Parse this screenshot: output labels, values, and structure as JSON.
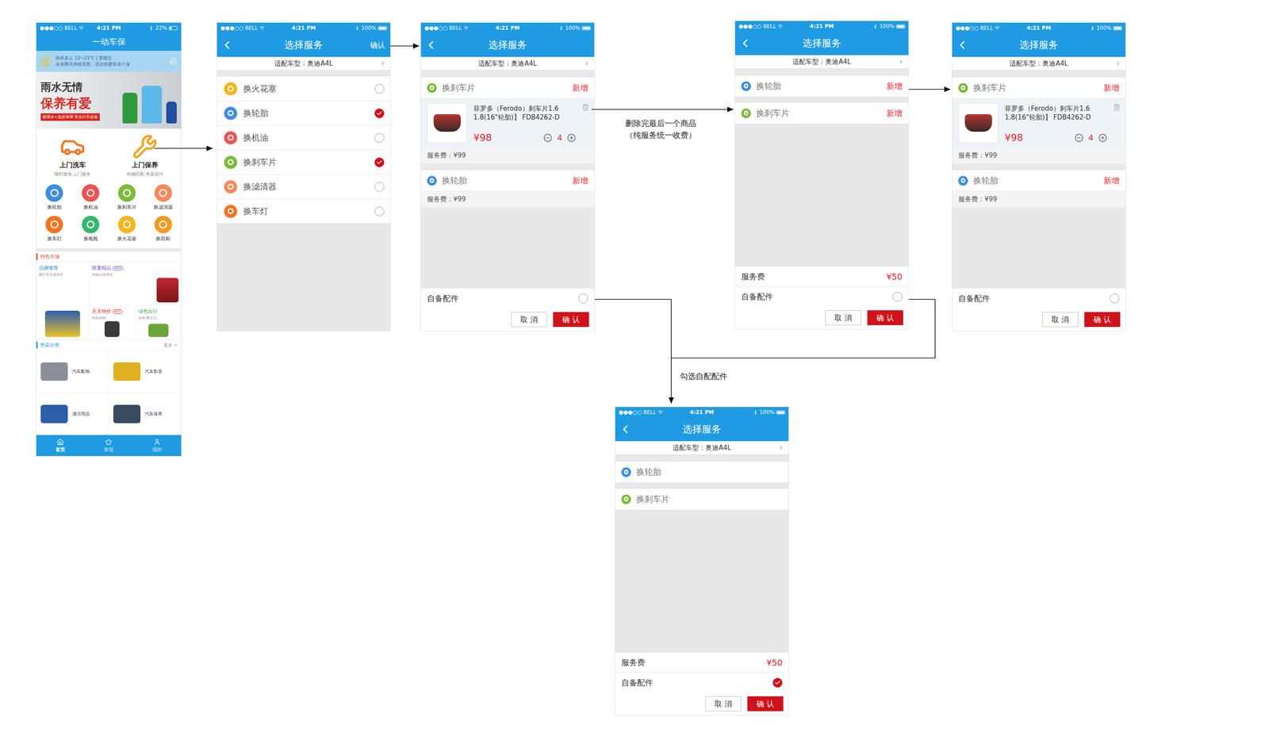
{
  "annotations": [
    {
      "lines": [
        "删除完最后一个商品",
        "（纯服务统一收费）"
      ]
    },
    {
      "lines": [
        "勾选自配配件"
      ]
    }
  ],
  "home": {
    "status": {
      "carrier": "●●●○○ BELL",
      "time": "4:21 PM",
      "battery": "22%"
    },
    "title": "一动车保",
    "weather": {
      "line1": "雨夹多云 13~23°C | 星期五",
      "line2": "未来两天持续无雨，适合给爱车洗个澡"
    },
    "banner": {
      "lines": [
        "雨水无情",
        "保养有爱"
      ],
      "caption": "玻璃水+低价保养 安全行车必备"
    },
    "services": [
      {
        "name": "上门洗车",
        "desc": "随时随地 上门服务"
      },
      {
        "name": "上门保养",
        "desc": "精确匹配 先装后付"
      }
    ],
    "shortcuts": [
      {
        "label": "换轮胎",
        "color": "#3d8ee0"
      },
      {
        "label": "换机油",
        "color": "#f05450"
      },
      {
        "label": "换刹车片",
        "color": "#7dbb3c"
      },
      {
        "label": "换滤清器",
        "color": "#f58a5a"
      },
      {
        "label": "换车灯",
        "color": "#f5731e"
      },
      {
        "label": "换电瓶",
        "color": "#33b86b"
      },
      {
        "label": "换火花塞",
        "color": "#f7b51c"
      },
      {
        "label": "换雨刷",
        "color": "#f59a23"
      }
    ],
    "featured": {
      "title": "特色市场",
      "items": [
        {
          "name": "品牌推荐",
          "desc": "暖炉安全成就车",
          "badge": "",
          "color": "#2f7fd6"
        },
        {
          "name": "限量精品",
          "desc": "特惠品质保证",
          "badge": "NEW",
          "color": "#7a4fc9"
        },
        {
          "name": "天天特价",
          "desc": "特美抢购",
          "badge": "HOT",
          "color": "#e8262d"
        },
        {
          "name": "绿色出行",
          "desc": "绿色·爱生活",
          "badge": "",
          "color": "#3aa64a"
        }
      ]
    },
    "hot": {
      "title": "热卖分类",
      "more": "更多 >",
      "items": [
        "汽车配饰",
        "汽车影音",
        "清洁用品",
        "汽车保养"
      ]
    },
    "tabs": [
      {
        "label": "首页",
        "selected": true
      },
      {
        "label": "发现",
        "selected": false
      },
      {
        "label": "我的",
        "selected": false
      }
    ]
  },
  "screens": [
    {
      "kind": "checklist",
      "status": {
        "carrier": "●●●○○ BELL",
        "time": "4:21 PM",
        "battery": "100%"
      },
      "title": "选择服务",
      "action": "确认",
      "model": "适配车型：奥迪A4L",
      "options": [
        {
          "label": "换火花塞",
          "color": "#f7b51c",
          "checked": false
        },
        {
          "label": "换轮胎",
          "color": "#3d8ee0",
          "checked": true
        },
        {
          "label": "换机油",
          "color": "#f05450",
          "checked": false
        },
        {
          "label": "换刹车片",
          "color": "#7dbb3c",
          "checked": true
        },
        {
          "label": "换滤清器",
          "color": "#f58a5a",
          "checked": false
        },
        {
          "label": "换车灯",
          "color": "#f5731e",
          "checked": false
        }
      ]
    },
    {
      "kind": "cart",
      "status": {
        "carrier": "●●●○○ BELL",
        "time": "4:21 PM",
        "battery": "100%"
      },
      "title": "选择服务",
      "action": "",
      "model": "适配车型：奥迪A4L",
      "sections": [
        {
          "name": "换刹车片",
          "color": "#7dbb3c",
          "tag": "新增",
          "product": {
            "name": "菲罗多（Ferodo）刹车片1.6 1.8(16\"轮胎)】 FDB4262-D",
            "price": "¥98",
            "qty": "4"
          },
          "fee": "服务费：¥99"
        },
        {
          "name": "换轮胎",
          "color": "#3d8ee0",
          "tag": "新增",
          "fee": "服务费：¥99"
        }
      ],
      "ownParts": {
        "label": "自备配件",
        "checked": false
      },
      "buttons": [
        "取 消",
        "确 认"
      ]
    },
    {
      "kind": "cart",
      "status": {
        "carrier": "●●●○○ BELL",
        "time": "4:21 PM",
        "battery": "100%"
      },
      "title": "选择服务",
      "action": "",
      "model": "适配车型：奥迪A4L",
      "sections": [
        {
          "name": "换轮胎",
          "color": "#3d8ee0",
          "tag": "新增"
        },
        {
          "name": "换刹车片",
          "color": "#7dbb3c",
          "tag": "新增"
        }
      ],
      "total": {
        "label": "服务费",
        "value": "¥50"
      },
      "ownParts": {
        "label": "自备配件",
        "checked": false
      },
      "buttons": [
        "取 消",
        "确 认"
      ]
    },
    {
      "kind": "cart",
      "status": {
        "carrier": "●●●○○ BELL",
        "time": "4:21 PM",
        "battery": "100%"
      },
      "title": "选择服务",
      "action": "",
      "model": "适配车型：奥迪A4L",
      "sections": [
        {
          "name": "换刹车片",
          "color": "#7dbb3c",
          "tag": "新增",
          "product": {
            "name": "菲罗多（Ferodo）刹车片1.6 1.8(16\"轮胎)】 FDB4262-D",
            "price": "¥98",
            "qty": "4"
          },
          "fee": "服务费：¥99"
        },
        {
          "name": "换轮胎",
          "color": "#3d8ee0",
          "tag": "新增",
          "fee": "服务费：¥99"
        }
      ],
      "ownParts": {
        "label": "自备配件",
        "checked": false
      },
      "buttons": [
        "取 消",
        "确 认"
      ]
    },
    {
      "kind": "cart",
      "status": {
        "carrier": "●●●○○ BELL",
        "time": "4:21 PM",
        "battery": "100%"
      },
      "title": "选择服务",
      "action": "",
      "model": "适配车型：奥迪A4L",
      "sections": [
        {
          "name": "换轮胎",
          "color": "#3d8ee0",
          "tag": ""
        },
        {
          "name": "换刹车片",
          "color": "#7dbb3c",
          "tag": ""
        }
      ],
      "total": {
        "label": "服务费",
        "value": "¥50"
      },
      "ownParts": {
        "label": "自备配件",
        "checked": true
      },
      "buttons": [
        "取 消",
        "确 认"
      ]
    }
  ]
}
